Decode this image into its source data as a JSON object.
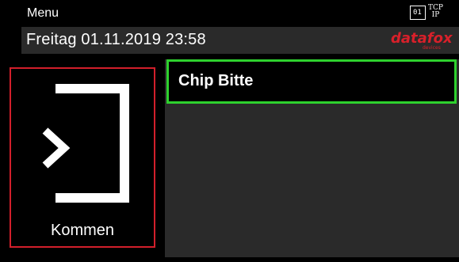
{
  "header": {
    "menu_label": "Menu",
    "status_sim": "01",
    "status_tcp_line1": "TCP",
    "status_tcp_line2": "IP"
  },
  "datebar": {
    "datetime": "Freitag 01.11.2019 23:58",
    "logo_text": "datafox",
    "logo_sub": "devices"
  },
  "tile": {
    "label": "Kommen",
    "border_color": "#d21f2b",
    "icon": "login-arrow-icon"
  },
  "input": {
    "value": "Chip Bitte",
    "border_color": "#2ed12e"
  }
}
